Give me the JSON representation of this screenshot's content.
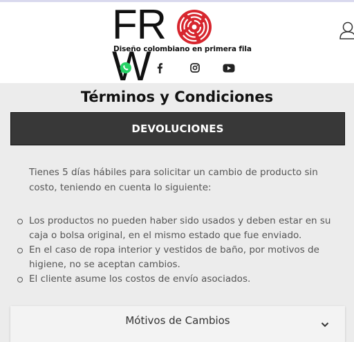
{
  "header": {
    "logo_text": "FROW",
    "logo_tagline": "Diseño colombiano en primera fila",
    "social": [
      "whatsapp-icon",
      "facebook-icon",
      "instagram-icon",
      "youtube-icon"
    ],
    "user_icon": "user-icon",
    "brand_red": "#d7262e"
  },
  "page": {
    "title": "Términos y Condiciones",
    "section_label": "DEVOLUCIONES",
    "intro": "Tienes 5 días hábiles para solicitar un cambio de producto sin costo, teniendo en cuenta lo siguiente:",
    "conditions": [
      "Los productos no pueden haber sido usados y deben estar en su caja o bolsa original, en el mismo estado que fue enviado.",
      "En el caso de ropa interior y vestidos de baño, por motivos de higiene, no se aceptan cambios.",
      "El cliente asume los costos de envío asociados."
    ],
    "accordion_label": "Mótivos de Cambios"
  }
}
